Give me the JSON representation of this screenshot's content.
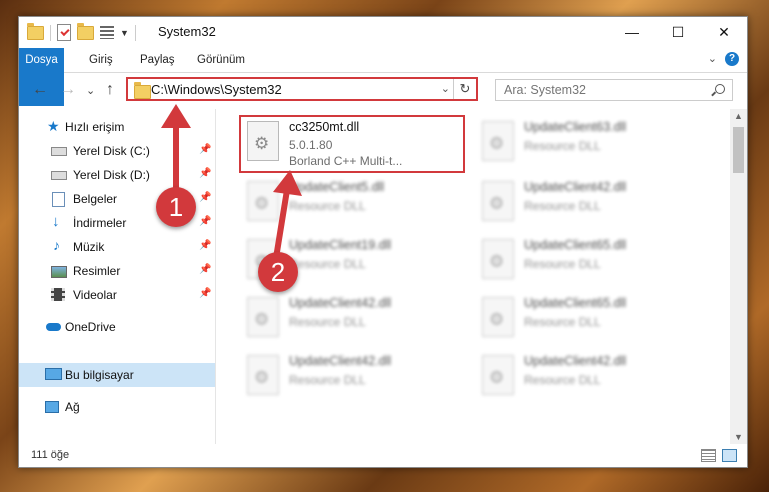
{
  "titlebar": {
    "title": "System32",
    "minimize": "—",
    "maximize": "☐",
    "close": "✕"
  },
  "ribbon": {
    "tabs": [
      "Dosya",
      "Giriş",
      "Paylaş",
      "Görünüm"
    ],
    "expand_caret": "⌄",
    "help": "?"
  },
  "nav": {
    "back": "←",
    "forward": "→",
    "recent": "⌄",
    "up": "↑",
    "address": "C:\\Windows\\System32",
    "address_dropdown": "⌄",
    "refresh": "↻",
    "search_placeholder": "Ara: System32"
  },
  "sidebar": {
    "items": [
      {
        "label": "Hızlı erişim",
        "icon": "star-icon",
        "pinned": false
      },
      {
        "label": "Yerel Disk (C:)",
        "icon": "drive-icon",
        "pinned": true
      },
      {
        "label": "Yerel Disk (D:)",
        "icon": "drive-icon",
        "pinned": true
      },
      {
        "label": "Belgeler",
        "icon": "documents-icon",
        "pinned": true
      },
      {
        "label": "İndirmeler",
        "icon": "downloads-icon",
        "pinned": true
      },
      {
        "label": "Müzik",
        "icon": "music-icon",
        "pinned": true
      },
      {
        "label": "Resimler",
        "icon": "pictures-icon",
        "pinned": true
      },
      {
        "label": "Videolar",
        "icon": "videos-icon",
        "pinned": true
      },
      {
        "label": "OneDrive",
        "icon": "cloud-icon",
        "pinned": false
      },
      {
        "label": "Bu bilgisayar",
        "icon": "computer-icon",
        "pinned": false,
        "selected": true
      },
      {
        "label": "Ağ",
        "icon": "network-icon",
        "pinned": false
      }
    ],
    "pin_glyph": "📌"
  },
  "files": [
    {
      "name": "cc3250mt.dll",
      "version": "5.0.1.80",
      "description": "Borland C++ Multi-t...",
      "highlighted": true
    },
    {
      "name": "UpdateClient63.dll",
      "version": "",
      "description": "Resource DLL"
    },
    {
      "name": "UpdateClient5.dll",
      "version": "",
      "description": "Resource DLL"
    },
    {
      "name": "UpdateClient42.dll",
      "version": "",
      "description": "Resource DLL"
    },
    {
      "name": "UpdateClient19.dll",
      "version": "",
      "description": "Resource DLL"
    },
    {
      "name": "UpdateClient65.dll",
      "version": "",
      "description": "Resource DLL"
    },
    {
      "name": "UpdateClient42.dll",
      "version": "",
      "description": "Resource DLL"
    },
    {
      "name": "UpdateClient65.dll",
      "version": "",
      "description": "Resource DLL"
    },
    {
      "name": "UpdateClient42.dll",
      "version": "",
      "description": "Resource DLL"
    },
    {
      "name": "UpdateClient42.dll",
      "version": "",
      "description": "Resource DLL"
    }
  ],
  "status": {
    "count": "111 öğe"
  },
  "annotations": {
    "step1": "1",
    "step2": "2",
    "color": "#d2393c"
  }
}
